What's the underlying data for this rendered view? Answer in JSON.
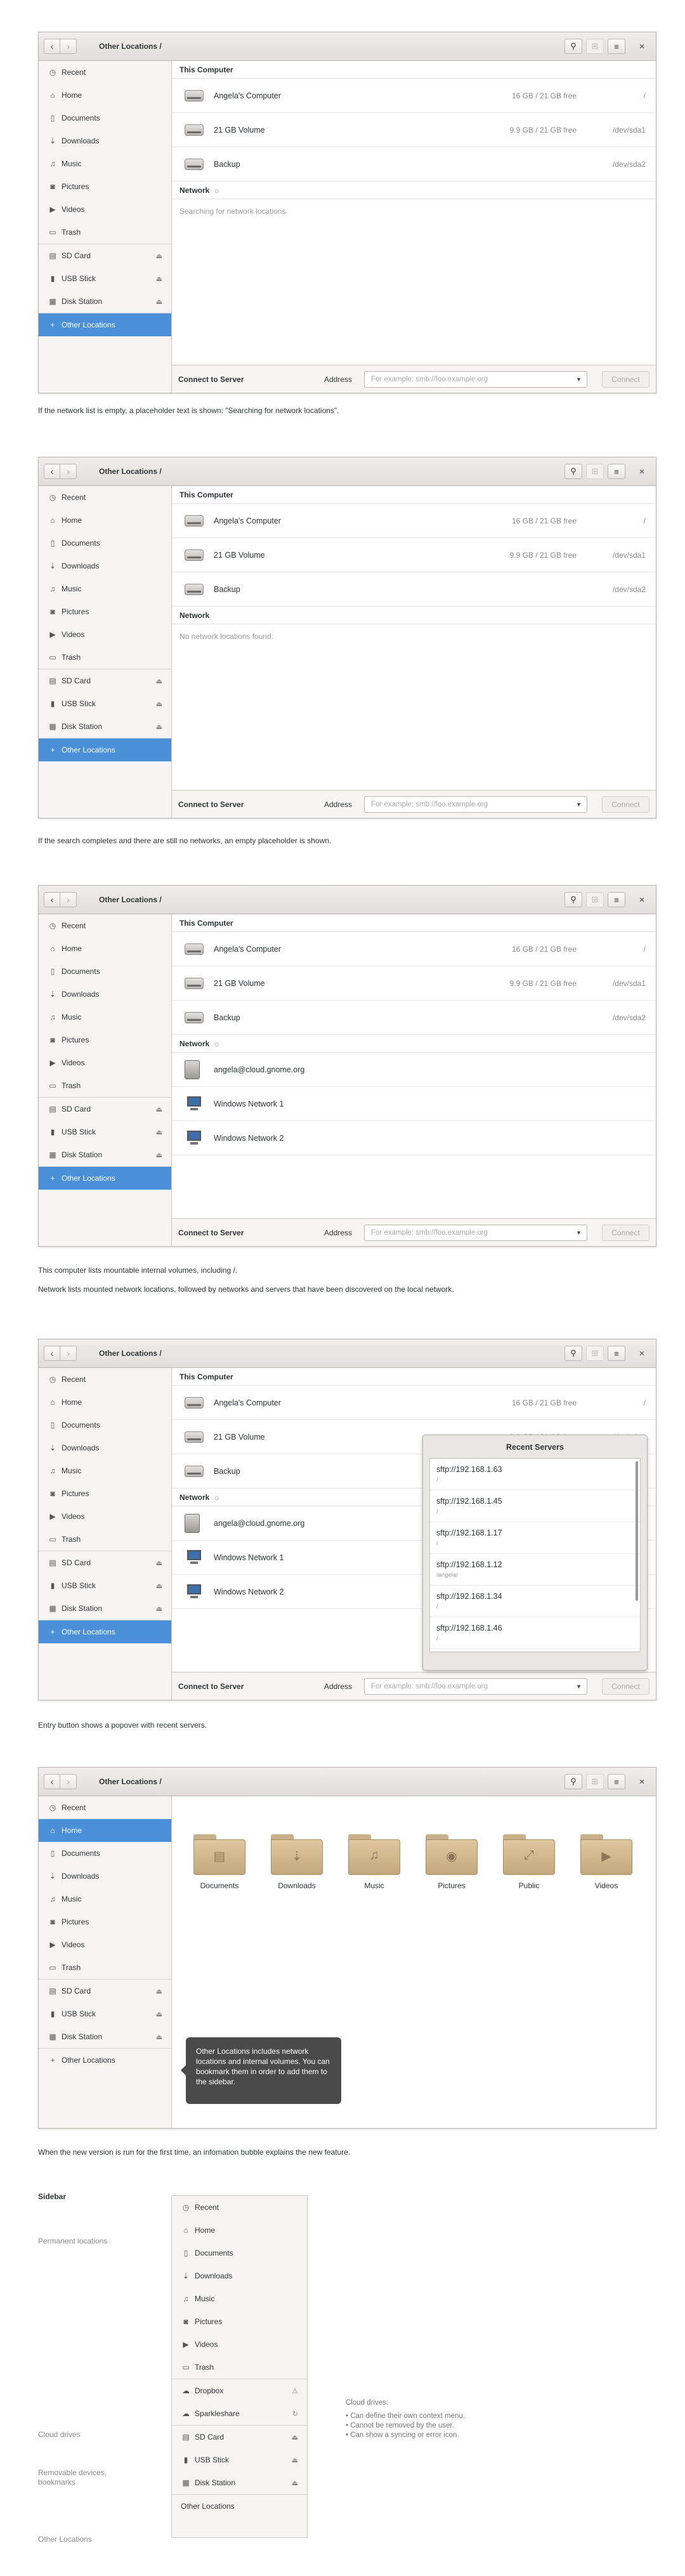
{
  "window": {
    "path": "Other Locations  /",
    "close": "×"
  },
  "sidebar": {
    "items": [
      {
        "label": "Recent",
        "icon": "clock-icon",
        "glyph": "◷"
      },
      {
        "label": "Home",
        "icon": "home-icon",
        "glyph": "⌂"
      },
      {
        "label": "Documents",
        "icon": "document-icon",
        "glyph": "▯"
      },
      {
        "label": "Downloads",
        "icon": "download-icon",
        "glyph": "⇣"
      },
      {
        "label": "Music",
        "icon": "music-icon",
        "glyph": "♫"
      },
      {
        "label": "Pictures",
        "icon": "camera-icon",
        "glyph": "◙"
      },
      {
        "label": "Videos",
        "icon": "video-icon",
        "glyph": "▶"
      },
      {
        "label": "Trash",
        "icon": "trash-icon",
        "glyph": "▭"
      }
    ],
    "devices": [
      {
        "label": "SD Card",
        "icon": "sd-card-icon",
        "glyph": "▤"
      },
      {
        "label": "USB Stick",
        "icon": "usb-icon",
        "glyph": "▮"
      },
      {
        "label": "Disk Station",
        "icon": "disk-icon",
        "glyph": "▦"
      }
    ],
    "eject": "⏏",
    "other": "Other Locations",
    "other_glyph": "+"
  },
  "main": {
    "this_computer": "This Computer",
    "volumes": [
      {
        "name": "Angela's Computer",
        "size": "16 GB / 21 GB free",
        "dev": "/"
      },
      {
        "name": "21 GB Volume",
        "size": "9.9 GB / 21 GB free",
        "dev": "/dev/sda1"
      },
      {
        "name": "Backup",
        "size": "",
        "dev": "/dev/sda2"
      }
    ],
    "network": "Network",
    "searching": "Searching for network locations",
    "no_network": "No network locations found.",
    "network_items": [
      "angela@cloud.gnome.org",
      "Windows Network 1",
      "Windows Network 2"
    ]
  },
  "bottom": {
    "connect_to_server": "Connect to Server",
    "address_label": "Address",
    "address_placeholder": "For example: smb://foo.example.org",
    "connect_button": "Connect"
  },
  "popover": {
    "title": "Recent Servers",
    "servers": [
      {
        "url": "sftp://192.168.1.63",
        "sub": "/"
      },
      {
        "url": "sftp://192.168.1.45",
        "sub": "/"
      },
      {
        "url": "sftp://192.168.1.17",
        "sub": "/"
      },
      {
        "url": "sftp://192.168.1.12",
        "sub": "/angela/"
      },
      {
        "url": "sftp://192.168.1.34",
        "sub": "/"
      },
      {
        "url": "sftp://192.168.1.46",
        "sub": "/"
      }
    ]
  },
  "home_folders": [
    "Documents",
    "Downloads",
    "Music",
    "Pictures",
    "Public",
    "Videos"
  ],
  "bubble": "Other Locations includes network locations and internal volumes. You can bookmark them in order to add them to the sidebar.",
  "captions": {
    "c1": "If the network list is empty, a placeholder text is shown: \"Searching for network locations\".",
    "c2": "If the search completes and there are still no networks, an empty placeholder is shown.",
    "c3a": "This computer lists mountable internal volumes, including /.",
    "c3b": "Network lists mounted network locations, followed by networks and servers that have been discovered on the local network.",
    "c4": "Entry button shows a popover with recent servers.",
    "c5": "When the new version is run for the first time, an infomation bubble explains the new feature."
  },
  "sidebar_section": {
    "title": "Sidebar",
    "permanent": "Permanent locations",
    "cloud": "Cloud drives",
    "removable": "Removable devices, bookmarks",
    "other": "Other Locations",
    "cloud_items": [
      {
        "label": "Dropbox",
        "badge": "⚠"
      },
      {
        "label": "Sparkleshare",
        "badge": "↻"
      }
    ],
    "note_title": "Cloud drives:",
    "notes": [
      "Can define their own context menu.",
      "Cannot be removed by the user.",
      "Can show a syncing or error icon."
    ]
  }
}
